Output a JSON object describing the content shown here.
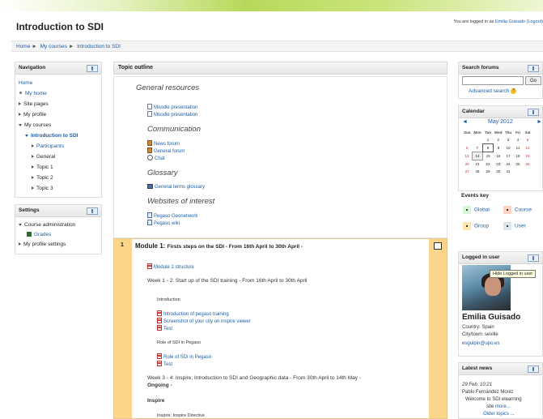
{
  "site": {
    "title": "Introduction to SDI",
    "login_prefix": "You are logged in as",
    "login_user": "Emilia Guisado (Logout)"
  },
  "breadcrumb": [
    "Home",
    "My courses",
    "Introduction to SDI"
  ],
  "navigation": {
    "title": "Navigation",
    "home": "Home",
    "my_home": "My home",
    "site_pages": "Site pages",
    "my_profile": "My profile",
    "my_courses": "My courses",
    "course": "Introduction to SDI",
    "participants": "Participants",
    "general": "General",
    "topics": [
      "Topic 1",
      "Topic 2",
      "Topic 3"
    ]
  },
  "settings": {
    "title": "Settings",
    "course_admin": "Course administration",
    "grades": "Grades",
    "profile_settings": "My profile settings"
  },
  "topic_outline": {
    "title": "Topic outline",
    "general_resources": "General resources",
    "moodle_pres_1": "Moodle presentation",
    "moodle_pres_2": "Moodle presentation",
    "communication": "Communication",
    "news_forum": "News forum",
    "general_forum": "General forum",
    "chat": "Chat",
    "glossary": "Glossary",
    "general_glossary": "General terms glossary",
    "websites": "Websites of interest",
    "geonetwork": "Pegaso Geonetwork",
    "wiki": "Pegaso wiki"
  },
  "module1": {
    "number": "1",
    "title": "Module 1:",
    "subtitle": "Firsts steps on the SDI - From 16th April to 30th April -",
    "structure": "Module 1 structure",
    "week12": "Week 1 - 2: Start up of the SDI training - From 16th April to 30th April",
    "introduction": "Introduction",
    "intro_pegaso": "Introduction of pegaso training",
    "screenshot": "Screenshot of your city on inspire viewer",
    "test1": "Test",
    "role_label": "Role of SDI in Pegaso",
    "role_link": "Role of SDI in Pegaso",
    "test2": "Test",
    "week34": "Week 3 - 4: Inspire, Introduction to SDI and Geographic data - From 30th April to 14th May -",
    "ongoing": "Ongoing -",
    "inspire": "Inspire",
    "inspire_directive": "Inspire: Inspire Directive"
  },
  "search_forums": {
    "title": "Search forums",
    "go": "Go",
    "advanced": "Advanced search",
    "help": "?"
  },
  "calendar": {
    "title": "Calendar",
    "prev": "◄",
    "next": "►",
    "month": "May 2012",
    "days": [
      "Sun",
      "Mon",
      "Tue",
      "Wed",
      "Thu",
      "Fri",
      "Sat"
    ],
    "weeks": [
      [
        "",
        "",
        "1",
        "2",
        "3",
        "4",
        "5"
      ],
      [
        "6",
        "7",
        "8",
        "9",
        "10",
        "11",
        "12"
      ],
      [
        "13",
        "14",
        "15",
        "16",
        "17",
        "18",
        "19"
      ],
      [
        "20",
        "21",
        "22",
        "23",
        "24",
        "25",
        "26"
      ],
      [
        "27",
        "28",
        "29",
        "30",
        "31",
        "",
        ""
      ]
    ],
    "today": "8",
    "event_day": "14"
  },
  "events_key": {
    "title": "Events key",
    "global": "Global",
    "course": "Course",
    "group": "Group",
    "user": "User",
    "colors": {
      "global": "#d6f6d6",
      "course": "#ffd3bd",
      "group": "#fee7ae",
      "user": "#dce7ec"
    }
  },
  "logged_in_user": {
    "title": "Logged in user",
    "tooltip": "Hide Logged in user",
    "name": "Emilia Guisado",
    "country": "Country: Spain",
    "city": "City/town: seville",
    "email": "esguipin@upo.es"
  },
  "latest_news": {
    "title": "Latest news",
    "date": "29 Feb, 10:21",
    "author": "Pablo Fernández Moniz",
    "text": "Welcome to SDI elearning",
    "more_prefix": "site",
    "more": "more...",
    "older": "Older topics ..."
  }
}
